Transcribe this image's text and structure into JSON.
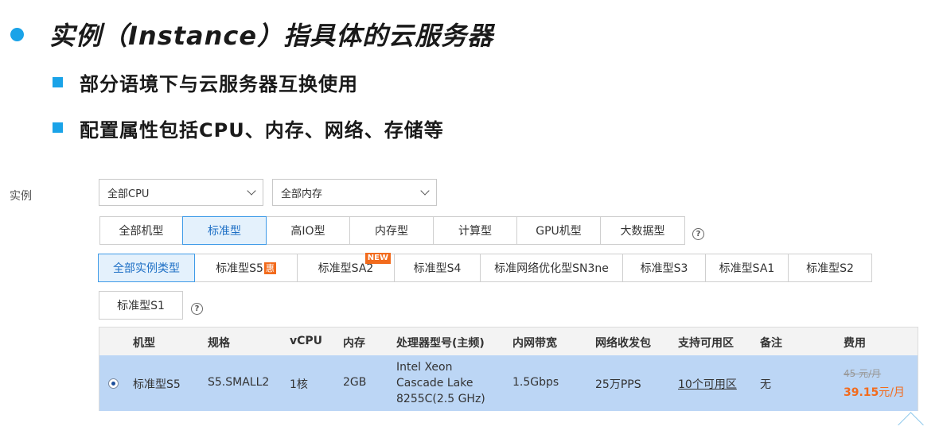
{
  "slide": {
    "title": "实例（Instance）指具体的云服务器",
    "points": [
      "部分语境下与云服务器互换使用",
      "配置属性包括CPU、内存、网络、存储等"
    ]
  },
  "instance_label": "实例",
  "filters": {
    "cpu_select": "全部CPU",
    "memory_select": "全部内存"
  },
  "families": [
    "全部机型",
    "标准型",
    "高IO型",
    "内存型",
    "计算型",
    "GPU机型",
    "大数据型"
  ],
  "help_glyph": "?",
  "types": {
    "all": "全部实例类型",
    "s5": "标准型S5",
    "s5_badge": "惠",
    "sa2": "标准型SA2",
    "sa2_badge": "NEW",
    "s4": "标准型S4",
    "sn3ne": "标准网络优化型SN3ne",
    "s3": "标准型S3",
    "sa1": "标准型SA1",
    "s2": "标准型S2",
    "s1": "标准型S1"
  },
  "table": {
    "headers": [
      "机型",
      "规格",
      "vCPU",
      "内存",
      "处理器型号(主频)",
      "内网带宽",
      "网络收发包",
      "支持可用区",
      "备注",
      "费用"
    ],
    "row": {
      "model": "标准型S5",
      "spec": "S5.SMALL2",
      "vcpu": "1核",
      "memory": "2GB",
      "cpu_lines": [
        "Intel Xeon",
        "Cascade Lake",
        "8255C(2.5 GHz)"
      ],
      "bandwidth": "1.5Gbps",
      "pps": "25万PPS",
      "zones": "10个可用区",
      "note": "无",
      "orig_price": "45 元/月",
      "price_value": "39.15",
      "price_unit": "元/月"
    }
  },
  "colors": {
    "accent": "#1aa3e8",
    "active_tab": "#3f9be8",
    "selected_row": "#bcd6f5",
    "badge": "#f26b1d"
  }
}
